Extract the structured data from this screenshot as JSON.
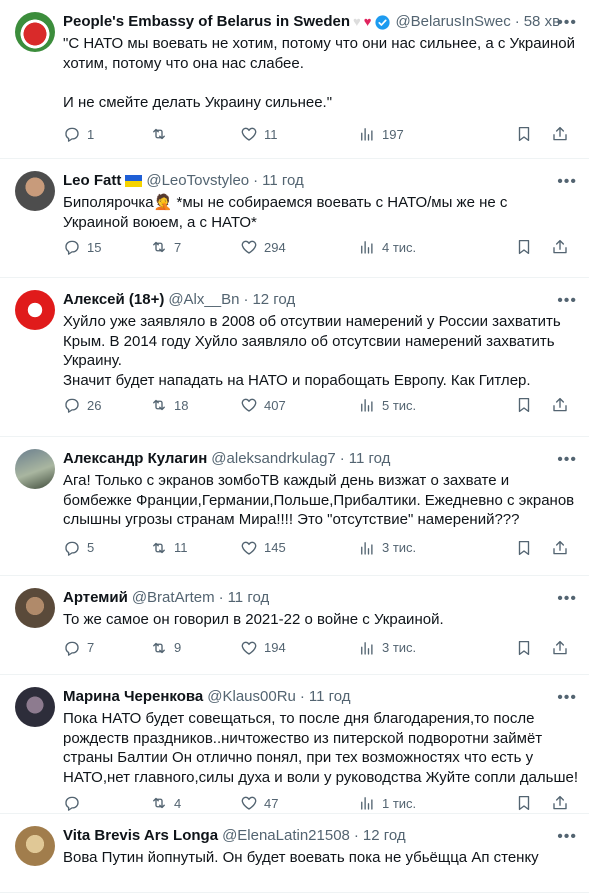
{
  "tweets": [
    {
      "name": "People's Embassy of Belarus in Sweden",
      "handle": "@BelarusInSwec",
      "time": "58 хв",
      "lines": [
        "\"С НАТО мы воевать не хотим, потому что они нас сильнее, а с Украиной",
        "хотим, потому что она нас слабее.",
        "",
        "И не смейте делать Украину сильнее.\""
      ],
      "replies": "1",
      "retweets": "",
      "likes": "11",
      "views": "197"
    },
    {
      "name": "Leo Fatt",
      "handle": "@LeoTovstyleo",
      "time": "11 год",
      "lines": [
        "Биполярочка🤦 *мы не собираемся воевать с НАТО/мы же не с",
        "Украиной воюем, а с НАТО*"
      ],
      "replies": "15",
      "retweets": "7",
      "likes": "294",
      "views": "4 тис."
    },
    {
      "name": "Алексей (18+)",
      "handle": "@Alx__Bn",
      "time": "12 год",
      "lines": [
        "Хуйло уже заявляло в 2008 об отсутвии намерений у России захватить",
        "Крым. В 2014 году Хуйло заявляло об отсутсвии намерений захватить",
        "Украину.",
        "Значит будет нападать на НАТО и порабощать Европу. Как Гитлер."
      ],
      "replies": "26",
      "retweets": "18",
      "likes": "407",
      "views": "5 тис."
    },
    {
      "name": "Александр Кулагин",
      "handle": "@aleksandrkulag7",
      "time": "11 год",
      "lines": [
        "Ага! Только с экранов зомбоТВ каждый день визжат о захвате и",
        "бомбежке Франции,Германии,Польше,Прибалтики. Ежедневно с экранов",
        "слышны угрозы странам Мира!!!! Это \"отсутствие\" намерений???"
      ],
      "replies": "5",
      "retweets": "11",
      "likes": "145",
      "views": "3 тис."
    },
    {
      "name": "Артемий",
      "handle": "@BratArtem",
      "time": "11 год",
      "lines": [
        "То же самое он говорил в 2021-22 о войне с Украиной."
      ],
      "replies": "7",
      "retweets": "9",
      "likes": "194",
      "views": "3 тис."
    },
    {
      "name": "Марина Черенкова",
      "handle": "@Klaus00Ru",
      "time": "11 год",
      "lines": [
        "Пока НАТО будет совещаться, то после дня благодарения,то после",
        "рождеств праздников..ничтожество из питерской подворотни займёт",
        "страны Балтии Он отлично понял, при тех возможностях что есть у",
        "НАТО,нет главного,силы духа и воли у руководства Жуйте сопли дальше!"
      ],
      "replies": "",
      "retweets": "4",
      "likes": "47",
      "views": "1 тис."
    },
    {
      "name": "Vita Brevis Ars Longa",
      "handle": "@ElenaLatin21508",
      "time": "12 год",
      "lines": [
        "Вова Путин йопнутый. Он будет воевать пока не убьёщца Ап стенку"
      ],
      "replies": "",
      "retweets": "",
      "likes": "",
      "views": ""
    }
  ],
  "icons": {
    "reply": "reply-icon",
    "retweet": "retweet-icon",
    "like": "like-icon",
    "views": "views-icon",
    "bookmark": "bookmark-icon",
    "share": "share-icon",
    "more": "more-icon"
  },
  "colors": {
    "text": "#0f1419",
    "secondary": "#536471",
    "divider": "#eff3f4",
    "verified": "#1d9bf0"
  }
}
